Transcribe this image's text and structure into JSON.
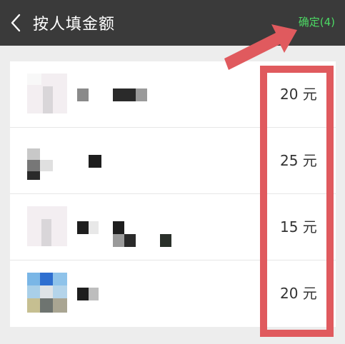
{
  "header": {
    "title": "按人填金额",
    "confirm_label": "确定(4)",
    "confirm_color": "#4cd964",
    "back_icon": "chevron-left-icon"
  },
  "rows": [
    {
      "amount": "20 元"
    },
    {
      "amount": "25 元"
    },
    {
      "amount": "15 元"
    },
    {
      "amount": "20 元"
    }
  ],
  "annotation": {
    "color": "#e05a5e"
  }
}
